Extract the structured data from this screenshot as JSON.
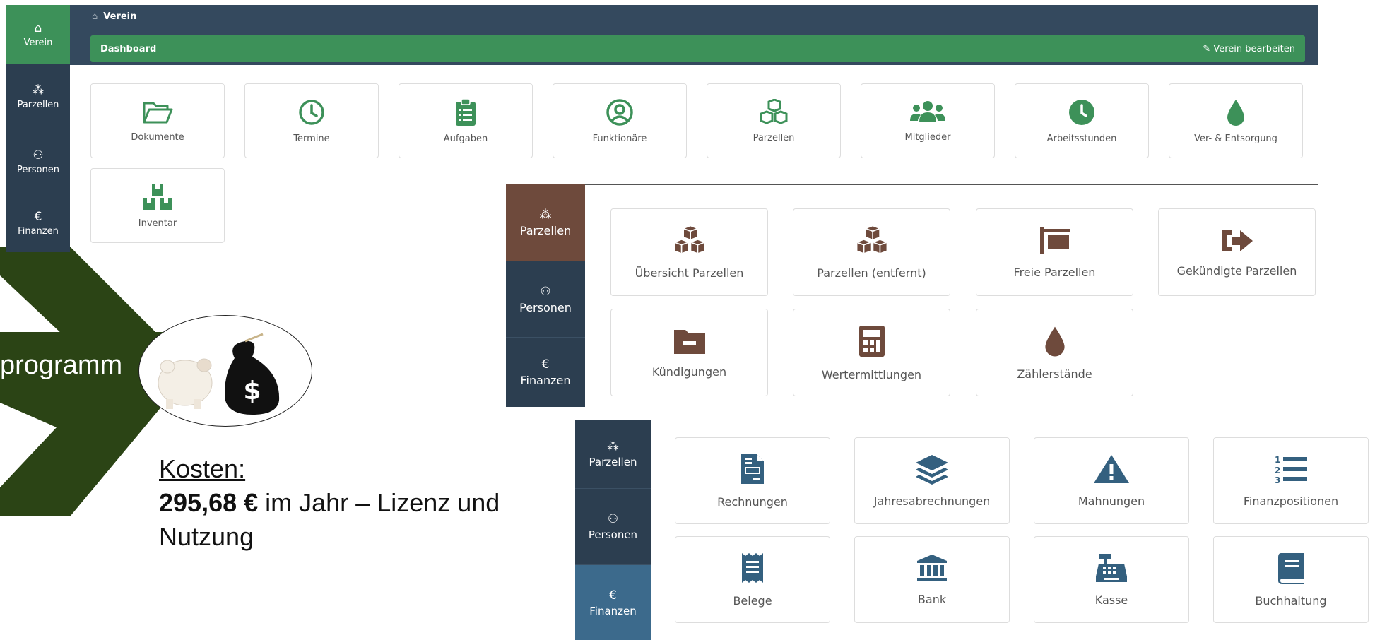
{
  "colors": {
    "green": "#3d9159",
    "brown": "#6e4a3c",
    "blue": "#34607f",
    "sidebar": "#2c3e50",
    "arrow": "#2b4415"
  },
  "presentation": {
    "program_text": "programm",
    "kosten_title": "Kosten:",
    "kosten_amount": "295,68 €",
    "kosten_rest": " im Jahr – Lizenz und",
    "kosten_line2": "Nutzung"
  },
  "panel1": {
    "sidebar": [
      {
        "label": "Verein",
        "icon": "home-icon"
      },
      {
        "label": "Parzellen",
        "icon": "cubes-icon"
      },
      {
        "label": "Personen",
        "icon": "users-icon"
      },
      {
        "label": "Finanzen",
        "icon": "euro-icon"
      }
    ],
    "breadcrumb": "Verein",
    "bar_title": "Dashboard",
    "edit_label": "Verein bearbeiten",
    "tiles": [
      {
        "label": "Dokumente",
        "icon": "folder-open-icon"
      },
      {
        "label": "Termine",
        "icon": "clock-icon"
      },
      {
        "label": "Aufgaben",
        "icon": "clipboard-list-icon"
      },
      {
        "label": "Funktionäre",
        "icon": "user-circle-icon"
      },
      {
        "label": "Parzellen",
        "icon": "cubes-icon"
      },
      {
        "label": "Mitglieder",
        "icon": "users-icon"
      },
      {
        "label": "Arbeitsstunden",
        "icon": "clock-solid-icon"
      },
      {
        "label": "Ver- & Entsorgung",
        "icon": "tint-icon"
      },
      {
        "label": "Inventar",
        "icon": "boxes-icon"
      }
    ]
  },
  "panel2": {
    "sidebar": [
      {
        "label": "Parzellen",
        "icon": "cubes-icon"
      },
      {
        "label": "Personen",
        "icon": "users-icon"
      },
      {
        "label": "Finanzen",
        "icon": "euro-icon"
      }
    ],
    "tiles": [
      {
        "label": "Übersicht Parzellen",
        "icon": "cubes-icon"
      },
      {
        "label": "Parzellen (entfernt)",
        "icon": "cubes-icon"
      },
      {
        "label": "Freie Parzellen",
        "icon": "sign-icon"
      },
      {
        "label": "Gekündigte Parzellen",
        "icon": "sign-out-icon"
      },
      {
        "label": "Kündigungen",
        "icon": "folder-minus-icon"
      },
      {
        "label": "Wertermittlungen",
        "icon": "calculator-icon"
      },
      {
        "label": "Zählerstände",
        "icon": "tint-icon"
      }
    ]
  },
  "panel3": {
    "sidebar": [
      {
        "label": "Parzellen",
        "icon": "cubes-icon"
      },
      {
        "label": "Personen",
        "icon": "users-icon"
      },
      {
        "label": "Finanzen",
        "icon": "euro-icon"
      }
    ],
    "tiles": [
      {
        "label": "Rechnungen",
        "icon": "file-invoice-icon"
      },
      {
        "label": "Jahresabrechnungen",
        "icon": "layer-group-icon"
      },
      {
        "label": "Mahnungen",
        "icon": "exclamation-triangle-icon"
      },
      {
        "label": "Finanzpositionen",
        "icon": "list-ol-icon"
      },
      {
        "label": "Belege",
        "icon": "receipt-icon"
      },
      {
        "label": "Bank",
        "icon": "bank-icon"
      },
      {
        "label": "Kasse",
        "icon": "cash-register-icon"
      },
      {
        "label": "Buchhaltung",
        "icon": "book-icon"
      }
    ]
  }
}
